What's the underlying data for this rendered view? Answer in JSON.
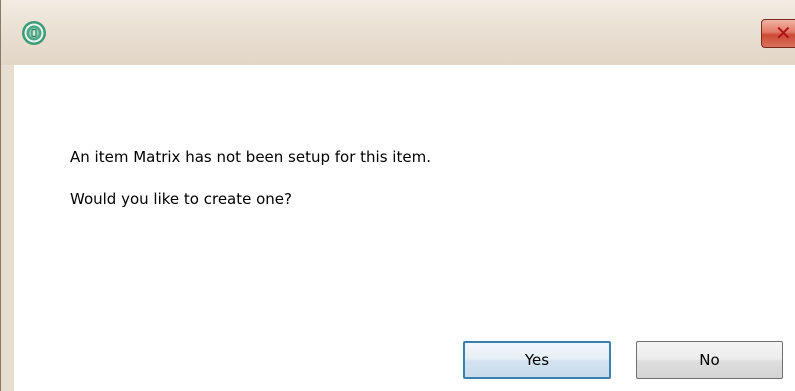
{
  "dialog": {
    "message_line1": "An item Matrix has not been setup for this item.",
    "message_line2": "Would you like to create one?",
    "buttons": {
      "yes_label": "Yes",
      "no_label": "No"
    },
    "close_glyph": "✕"
  },
  "icons": {
    "app": "app-logo-icon",
    "close": "close-icon"
  },
  "colors": {
    "titlebar": "#e7ddd0",
    "close_button": "#d8725d",
    "default_button_border": "#3c7fb1",
    "client_background": "#ffffff"
  }
}
